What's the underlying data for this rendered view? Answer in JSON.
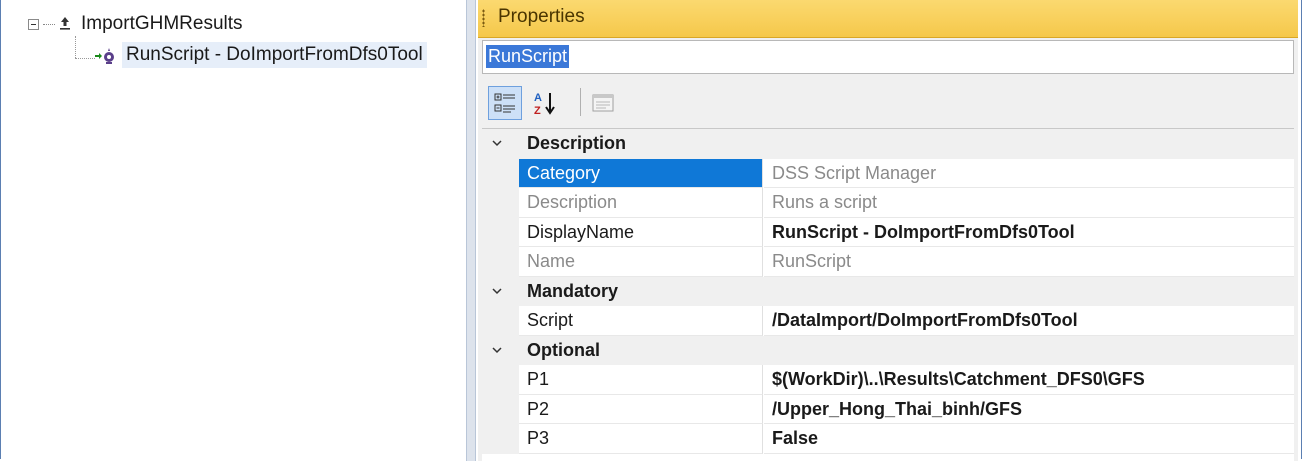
{
  "tree": {
    "items": [
      {
        "label": "ImportGHMResults"
      },
      {
        "label": "RunScript - DoImportFromDfs0Tool"
      }
    ]
  },
  "properties": {
    "title": "Properties",
    "object_name": "RunScript",
    "categories": [
      {
        "label": "Description",
        "rows": [
          {
            "name": "Category",
            "value": "DSS Script Manager"
          },
          {
            "name": "Description",
            "value": "Runs a script"
          },
          {
            "name": "DisplayName",
            "value": "RunScript - DoImportFromDfs0Tool"
          },
          {
            "name": "Name",
            "value": "RunScript"
          }
        ]
      },
      {
        "label": "Mandatory",
        "rows": [
          {
            "name": "Script",
            "value": "/DataImport/DoImportFromDfs0Tool"
          }
        ]
      },
      {
        "label": "Optional",
        "rows": [
          {
            "name": "P1",
            "value": "$(WorkDir)\\..\\Results\\Catchment_DFS0\\GFS"
          },
          {
            "name": "P2",
            "value": "/Upper_Hong_Thai_binh/GFS"
          },
          {
            "name": "P3",
            "value": "False"
          }
        ]
      }
    ]
  },
  "colors": {
    "header": "#f5c84a",
    "selection": "#0f78d7",
    "object_highlight": "#3b78d8"
  }
}
